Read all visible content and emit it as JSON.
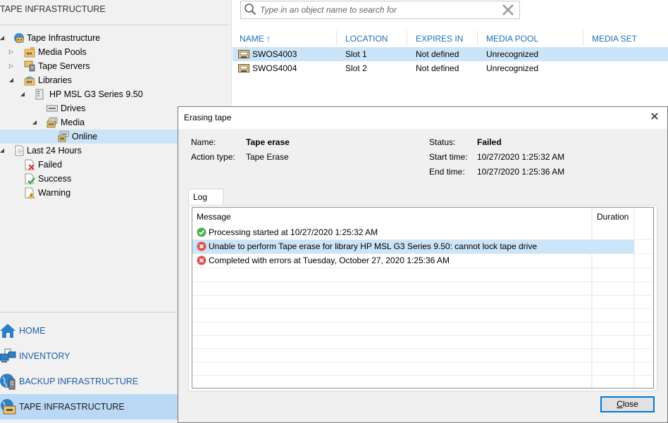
{
  "sidebar": {
    "title": "TAPE INFRASTRUCTURE",
    "tree": [
      {
        "label": "Tape Infrastructure",
        "icon": "tape-infrastructure-icon",
        "expanded": true,
        "level": 0
      },
      {
        "label": "Media Pools",
        "icon": "media-pool-icon",
        "expanded": false,
        "level": 1
      },
      {
        "label": "Tape Servers",
        "icon": "tape-server-icon",
        "expanded": false,
        "level": 1
      },
      {
        "label": "Libraries",
        "icon": "library-icon",
        "expanded": true,
        "level": 1
      },
      {
        "label": "HP MSL G3 Series 9.50",
        "icon": "tape-library-icon",
        "expanded": true,
        "level": 2
      },
      {
        "label": "Drives",
        "icon": "drive-icon",
        "level": 3
      },
      {
        "label": "Media",
        "icon": "media-icon",
        "expanded": true,
        "level": 3
      },
      {
        "label": "Online",
        "icon": "online-media-icon",
        "level": 4,
        "selected": true
      },
      {
        "label": "Last 24 Hours",
        "icon": "sessions-icon",
        "expanded": true,
        "level": 0
      },
      {
        "label": "Failed",
        "icon": "failed-session-icon",
        "level": 1
      },
      {
        "label": "Success",
        "icon": "success-session-icon",
        "level": 1
      },
      {
        "label": "Warning",
        "icon": "warning-session-icon",
        "level": 1
      }
    ],
    "nav": [
      {
        "label": "HOME",
        "icon": "home-icon"
      },
      {
        "label": "INVENTORY",
        "icon": "inventory-icon"
      },
      {
        "label": "BACKUP INFRASTRUCTURE",
        "icon": "backup-infrastructure-icon"
      },
      {
        "label": "TAPE INFRASTRUCTURE",
        "icon": "tape-infrastructure-nav-icon",
        "active": true
      }
    ]
  },
  "search": {
    "placeholder": "Type in an object name to search for",
    "value": ""
  },
  "grid": {
    "columns": [
      "NAME",
      "LOCATION",
      "EXPIRES IN",
      "MEDIA POOL",
      "MEDIA SET"
    ],
    "sort_indicator": "↑",
    "rows": [
      {
        "name": "SWOS4003",
        "location": "Slot 1",
        "expires_in": "Not defined",
        "media_pool": "Unrecognized",
        "media_set": "",
        "selected": true
      },
      {
        "name": "SWOS4004",
        "location": "Slot 2",
        "expires_in": "Not defined",
        "media_pool": "Unrecognized",
        "media_set": ""
      }
    ]
  },
  "dialog": {
    "title": "Erasing tape",
    "close_glyph": "✕",
    "name_label": "Name:",
    "name_value": "Tape erase",
    "action_type_label": "Action type:",
    "action_type_value": "Tape Erase",
    "status_label": "Status:",
    "status_value": "Failed",
    "start_time_label": "Start time:",
    "start_time_value": "10/27/2020 1:25:32 AM",
    "end_time_label": "End time:",
    "end_time_value": "10/27/2020 1:25:36 AM",
    "tab_log": "Log",
    "log": {
      "columns": [
        "Message",
        "Duration"
      ],
      "rows": [
        {
          "status": "success",
          "message": "Processing started at 10/27/2020 1:25:32 AM",
          "duration": ""
        },
        {
          "status": "error",
          "message": "Unable to perform Tape erase for library HP MSL G3 Series 9.50: cannot lock tape drive",
          "duration": "",
          "selected": true
        },
        {
          "status": "error",
          "message": "Completed with errors at Tuesday, October 27, 2020 1:25:36 AM",
          "duration": ""
        }
      ]
    },
    "close_button": {
      "mnemonic": "C",
      "rest": "lose"
    }
  },
  "colors": {
    "accent": "#1e6fb5",
    "selection": "#cce4f7",
    "nav_active": "#b9d9f7",
    "success": "#4caf50",
    "error": "#e05252",
    "focus_border": "#0078d7"
  }
}
